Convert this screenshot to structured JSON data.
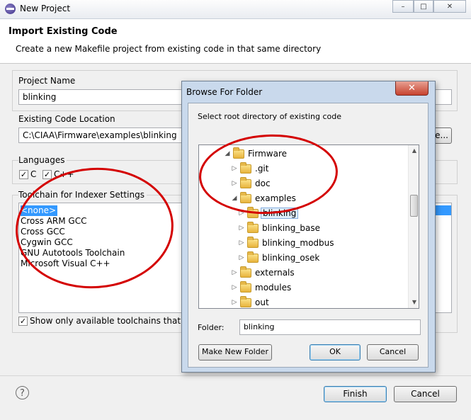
{
  "window": {
    "title": "New Project",
    "controls": [
      "–",
      "□",
      "✕"
    ]
  },
  "banner": {
    "title": "Import Existing Code",
    "description": "Create a new Makefile project from existing code in that same directory"
  },
  "project_name": {
    "label": "Project Name",
    "value": "blinking"
  },
  "code_location": {
    "label": "Existing Code Location",
    "value": "C:\\CIAA\\Firmware\\examples\\blinking",
    "browse_label": "se..."
  },
  "languages": {
    "label": "Languages",
    "c_label": "C",
    "cpp_label": "C++",
    "c_checked": true,
    "cpp_checked": true
  },
  "toolchain": {
    "label": "Toolchain for Indexer Settings",
    "items": [
      "<none>",
      "Cross ARM GCC",
      "Cross GCC",
      "Cygwin GCC",
      "GNU Autotools Toolchain",
      "Microsoft Visual C++"
    ],
    "selected": "<none>",
    "show_only_label": "Show only available toolchains that supp",
    "show_only_checked": true
  },
  "buttons": {
    "finish": "Finish",
    "cancel": "Cancel",
    "help": "?"
  },
  "browse_dialog": {
    "title": "Browse For Folder",
    "close": "✕",
    "description": "Select root directory of existing code",
    "tree": [
      {
        "name": "Firmware",
        "arrow": "◢"
      },
      {
        "name": ".git",
        "arrow": "▷"
      },
      {
        "name": "doc",
        "arrow": "▷"
      },
      {
        "name": "examples",
        "arrow": "◢"
      },
      {
        "name": "blinking",
        "arrow": "▷"
      },
      {
        "name": "blinking_base",
        "arrow": "▷"
      },
      {
        "name": "blinking_modbus",
        "arrow": "▷"
      },
      {
        "name": "blinking_osek",
        "arrow": "▷"
      },
      {
        "name": "externals",
        "arrow": "▷"
      },
      {
        "name": "modules",
        "arrow": "▷"
      },
      {
        "name": "out",
        "arrow": "▷"
      }
    ],
    "selected_folder": "blinking",
    "folder_label": "Folder:",
    "folder_value": "blinking",
    "make_new_folder": "Make New Folder",
    "ok": "OK",
    "cancel": "Cancel",
    "scroll_up": "▲",
    "scroll_down": "▼"
  },
  "colors": {
    "annotation": "#d40000",
    "selection": "#3399ff",
    "dialog_frame": "#c9d9ec"
  }
}
